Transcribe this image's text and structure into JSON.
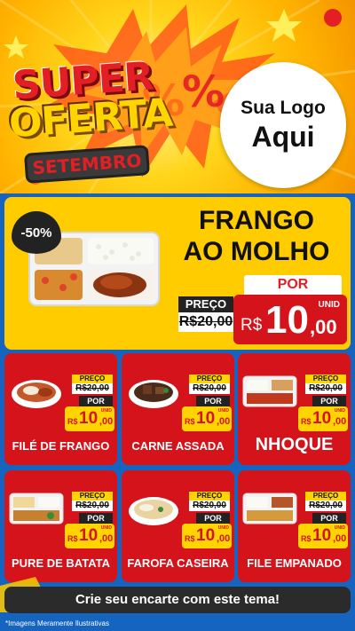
{
  "header": {
    "title_super": "SUPER",
    "title_oferta": "OFERTA",
    "title_month": "SETEMBRO",
    "logo_line1": "Sua Logo",
    "logo_line2": "Aqui"
  },
  "featured": {
    "discount": "-50%",
    "name_line1": "FRANGO",
    "name_line2": "AO MOLHO",
    "old_label": "PREÇO",
    "old_price": "R$20,00",
    "por_label": "POR",
    "currency": "R$",
    "price_int": "10",
    "price_dec": ",00",
    "unit": "UNID"
  },
  "items": [
    {
      "name": "FILÉ DE FRANGO",
      "old_label": "PREÇO",
      "old_price": "R$20,00",
      "por": "POR",
      "currency": "R$",
      "price_int": "10",
      "price_dec": ",00",
      "unit": "UNID"
    },
    {
      "name": "CARNE ASSADA",
      "old_label": "PREÇO",
      "old_price": "R$20,00",
      "por": "POR",
      "currency": "R$",
      "price_int": "10",
      "price_dec": ",00",
      "unit": "UNID"
    },
    {
      "name": "NHOQUE",
      "old_label": "PREÇO",
      "old_price": "R$20,00",
      "por": "POR",
      "currency": "R$",
      "price_int": "10",
      "price_dec": ",00",
      "unit": "UNID"
    },
    {
      "name": "PURE DE BATATA",
      "old_label": "PREÇO",
      "old_price": "R$20,00",
      "por": "POR",
      "currency": "R$",
      "price_int": "10",
      "price_dec": ",00",
      "unit": "UNID"
    },
    {
      "name": "FAROFA CASEIRA",
      "old_label": "PREÇO",
      "old_price": "R$20,00",
      "por": "POR",
      "currency": "R$",
      "price_int": "10",
      "price_dec": ",00",
      "unit": "UNID"
    },
    {
      "name": "FILE EMPANADO",
      "old_label": "PREÇO",
      "old_price": "R$20,00",
      "por": "POR",
      "currency": "R$",
      "price_int": "10",
      "price_dec": ",00",
      "unit": "UNID"
    }
  ],
  "footer": {
    "cta": "Crie seu encarte com este tema!",
    "note": "*Imagens Meramente Ilustrativas"
  },
  "colors": {
    "background": "#1565c0",
    "card_red": "#d4131b",
    "featured_yellow": "#ffcc00",
    "price_yellow": "#ffd400",
    "dark": "#222222"
  }
}
